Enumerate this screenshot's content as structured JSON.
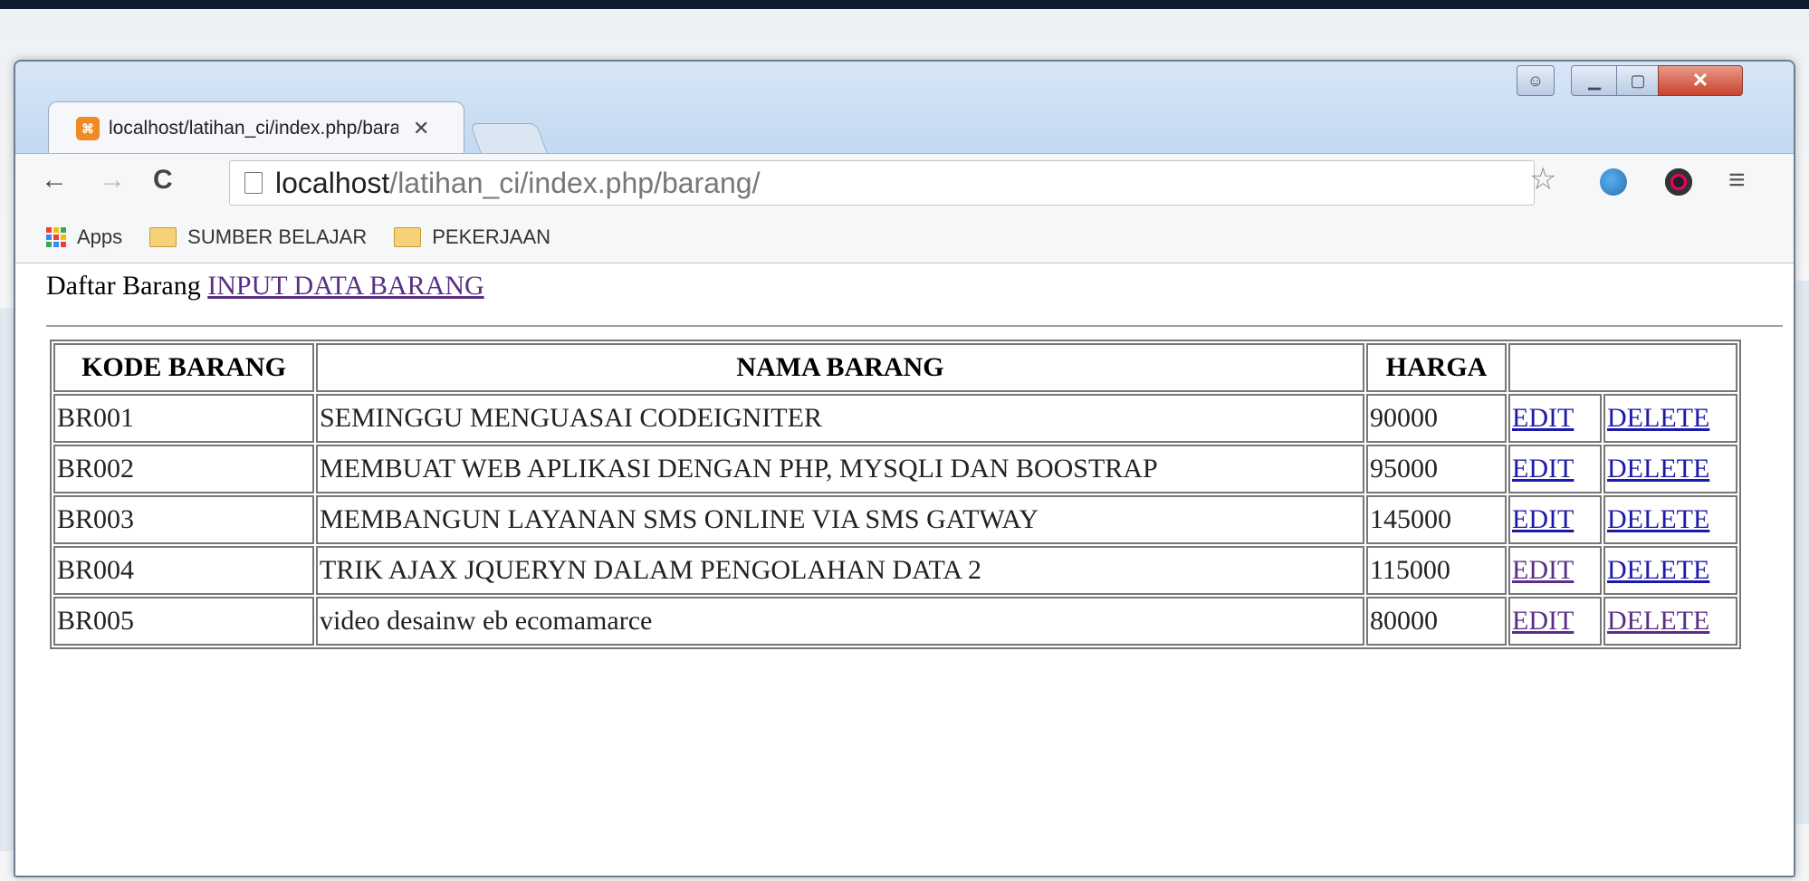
{
  "browser": {
    "tab_title": "localhost/latihan_ci/index.php/barang/",
    "url_host": "localhost",
    "url_path": "/latihan_ci/index.php/barang/",
    "bookmarks": [
      "Apps",
      "SUMBER BELAJAR",
      "PEKERJAAN"
    ],
    "accent_color": "#c6dbf2"
  },
  "page": {
    "heading": "Daftar Barang",
    "input_link": "INPUT DATA BARANG",
    "table": {
      "headers": [
        "KODE BARANG",
        "NAMA BARANG",
        "HARGA",
        ""
      ],
      "rows": [
        {
          "kode": "BR001",
          "nama": "SEMINGGU MENGUASAI CODEIGNITER",
          "harga": "90000",
          "edit": "EDIT",
          "delete": "DELETE"
        },
        {
          "kode": "BR002",
          "nama": "MEMBUAT WEB APLIKASI DENGAN PHP, MYSQLI DAN BOOSTRAP",
          "harga": "95000",
          "edit": "EDIT",
          "delete": "DELETE"
        },
        {
          "kode": "BR003",
          "nama": "MEMBANGUN LAYANAN SMS ONLINE VIA SMS GATWAY",
          "harga": "145000",
          "edit": "EDIT",
          "delete": "DELETE"
        },
        {
          "kode": "BR004",
          "nama": "TRIK AJAX JQUERYN DALAM PENGOLAHAN DATA 2",
          "harga": "115000",
          "edit": "EDIT",
          "delete": "DELETE"
        },
        {
          "kode": "BR005",
          "nama": "video desainw eb ecomamarce",
          "harga": "80000",
          "edit": "EDIT",
          "delete": "DELETE"
        }
      ]
    }
  }
}
